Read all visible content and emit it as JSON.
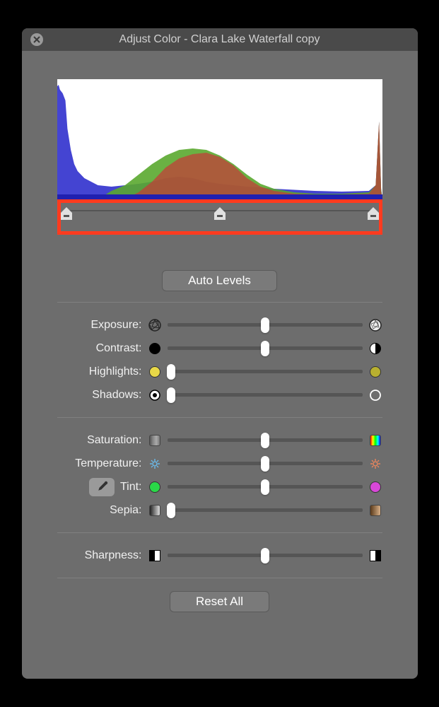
{
  "window": {
    "title": "Adjust Color - Clara Lake Waterfall copy"
  },
  "buttons": {
    "auto_levels": "Auto Levels",
    "reset_all": "Reset All"
  },
  "levels": {
    "black": 0,
    "mid": 50,
    "white": 100
  },
  "sliders": {
    "exposure": {
      "label": "Exposure:",
      "value": 50
    },
    "contrast": {
      "label": "Contrast:",
      "value": 50
    },
    "highlights": {
      "label": "Highlights:",
      "value": 2
    },
    "shadows": {
      "label": "Shadows:",
      "value": 2
    },
    "saturation": {
      "label": "Saturation:",
      "value": 50
    },
    "temperature": {
      "label": "Temperature:",
      "value": 50
    },
    "tint": {
      "label": "Tint:",
      "value": 50
    },
    "sepia": {
      "label": "Sepia:",
      "value": 2
    },
    "sharpness": {
      "label": "Sharpness:",
      "value": 50
    }
  },
  "colors": {
    "highlight_border": "#ff3b1f",
    "histogram_blue": "#3a3ad0",
    "histogram_green": "#5aa82f",
    "histogram_red": "#c83838"
  }
}
